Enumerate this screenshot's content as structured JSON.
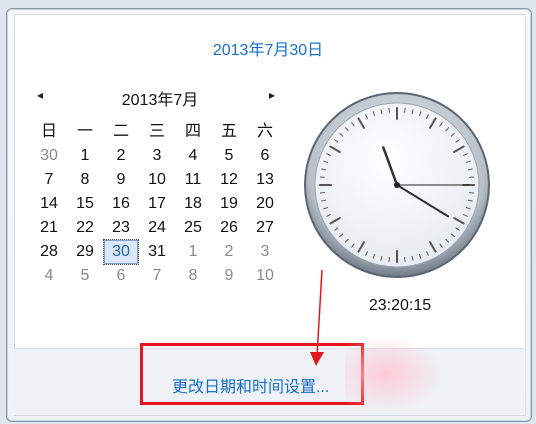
{
  "popup": {
    "full_date": "2013年7月30日",
    "month_title": "2013年7月",
    "prev_glyph": "◂",
    "next_glyph": "▸",
    "weekdays": [
      "日",
      "一",
      "二",
      "三",
      "四",
      "五",
      "六"
    ],
    "weeks": [
      [
        "30",
        "1",
        "2",
        "3",
        "4",
        "5",
        "6"
      ],
      [
        "7",
        "8",
        "9",
        "10",
        "11",
        "12",
        "13"
      ],
      [
        "14",
        "15",
        "16",
        "17",
        "18",
        "19",
        "20"
      ],
      [
        "21",
        "22",
        "23",
        "24",
        "25",
        "26",
        "27"
      ],
      [
        "28",
        "29",
        "30",
        "31",
        "1",
        "2",
        "3"
      ],
      [
        "4",
        "5",
        "6",
        "7",
        "8",
        "9",
        "10"
      ]
    ],
    "selected_day": "30",
    "time": "23:20:15",
    "settings_link": "更改日期和时间设置..."
  },
  "colors": {
    "link": "#1a6fc9",
    "annotation": "#e4161b"
  }
}
